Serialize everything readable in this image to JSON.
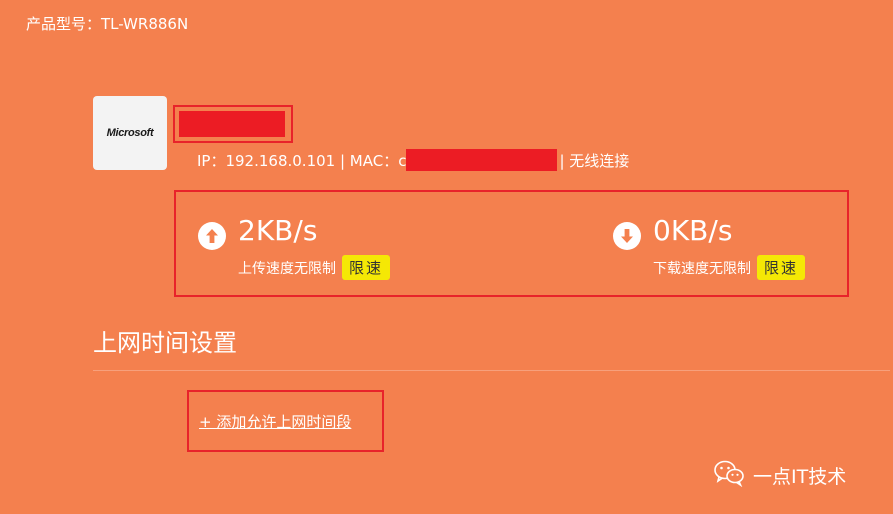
{
  "header": {
    "product_model": "产品型号：TL-WR886N"
  },
  "device": {
    "logo_text": "Microsoft",
    "ip_text": "IP：192.168.0.101 | MAC：c",
    "connection_text": "| 无线连接"
  },
  "speed": {
    "upload": {
      "value": "2KB/s",
      "caption": "上传速度无限制",
      "limit_label": "限速"
    },
    "download": {
      "value": "0KB/s",
      "caption": "下载速度无限制",
      "limit_label": "限速"
    }
  },
  "internet_time": {
    "title": "上网时间设置",
    "add_link": "+ 添加允许上网时间段"
  },
  "watermark": {
    "text": "一点IT技术",
    "icon": "wechat-icon"
  },
  "colors": {
    "background": "#f4804e",
    "highlight_border": "#e8232a",
    "redaction": "#ec1c24",
    "limit_button": "#f5e805"
  }
}
